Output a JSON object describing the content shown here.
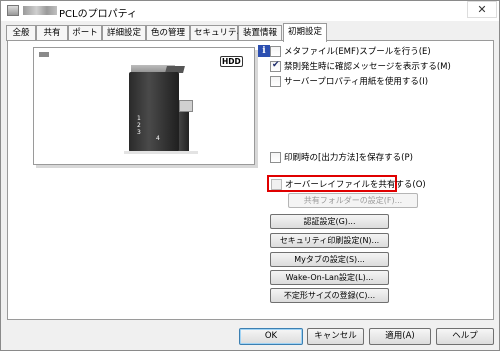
{
  "window": {
    "title": "PCLのプロパティ",
    "close_glyph": "✕"
  },
  "tabs": [
    {
      "label": "全般"
    },
    {
      "label": "共有"
    },
    {
      "label": "ポート"
    },
    {
      "label": "詳細設定"
    },
    {
      "label": "色の管理"
    },
    {
      "label": "セキュリティ"
    },
    {
      "label": "装置情報"
    },
    {
      "label": "初期設定",
      "active": true
    }
  ],
  "preview": {
    "hdd_badge": "HDD",
    "tray_numbers": "1\n2\n3",
    "tray_4": "4"
  },
  "info_icon_glyph": "i",
  "options": {
    "emf_spool": {
      "label": "メタファイル(EMF)スプールを行う(E)",
      "checked": false
    },
    "confirm_message": {
      "label": "禁則発生時に確認メッセージを表示する(M)",
      "checked": true
    },
    "server_paper": {
      "label": "サーバープロパティ用紙を使用する(I)",
      "checked": false
    },
    "save_output_method": {
      "label": "印刷時の[出力方法]を保存する(P)",
      "checked": false
    },
    "share_overlay": {
      "label": "オーバーレイファイルを共有する(O)",
      "checked": false
    },
    "share_folder_button": {
      "label": "共有フォルダーの設定(F)...",
      "disabled": true
    }
  },
  "buttons": {
    "auth_settings": "認証設定(G)...",
    "secure_print_settings": "セキュリティ印刷設定(N)...",
    "my_tab_settings": "Myタブの設定(S)...",
    "wake_on_lan": "Wake-On-Lan設定(L)...",
    "custom_size": "不定形サイズの登録(C)..."
  },
  "footer": {
    "ok": "OK",
    "cancel": "キャンセル",
    "apply": "適用(A)",
    "help": "ヘルプ"
  },
  "colors": {
    "highlight": "#e00000",
    "info_icon": "#2c4fb0"
  }
}
